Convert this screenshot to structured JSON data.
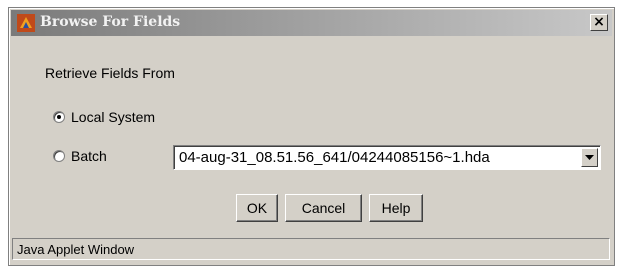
{
  "window": {
    "title": "Browse For Fields",
    "close_glyph": "×",
    "icon": "java-applet-icon"
  },
  "form": {
    "section_label": "Retrieve Fields From",
    "options": [
      {
        "label": "Local System",
        "selected": true
      },
      {
        "label": "Batch",
        "selected": false
      }
    ],
    "batch_file": "04-aug-31_08.51.56_641/04244085156~1.hda"
  },
  "buttons": {
    "ok": "OK",
    "cancel": "Cancel",
    "help": "Help"
  },
  "status_bar": {
    "text": "Java Applet Window"
  }
}
